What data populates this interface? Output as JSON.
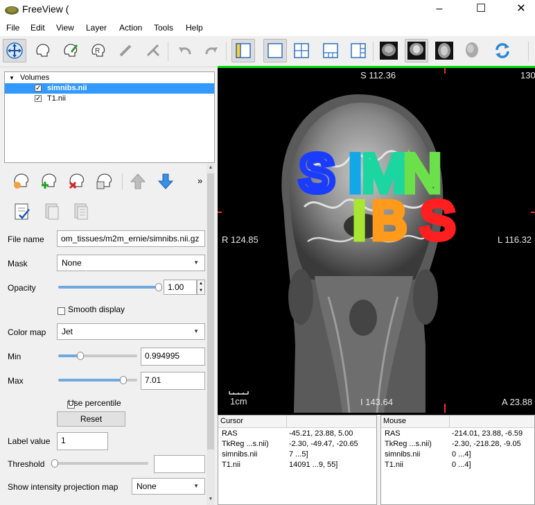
{
  "window": {
    "title": "FreeView (",
    "minimize": "–",
    "maximize": "☐",
    "close": "✕"
  },
  "menu": [
    "File",
    "Edit",
    "View",
    "Layer",
    "Action",
    "Tools",
    "Help"
  ],
  "layers": {
    "group": "Volumes",
    "items": [
      {
        "name": "simnibs.nii",
        "checked": true,
        "selected": true
      },
      {
        "name": "T1.nii",
        "checked": true,
        "selected": false
      }
    ]
  },
  "props": {
    "file_name_label": "File name",
    "file_name_value": "om_tissues/m2m_ernie/simnibs.nii.gz",
    "mask_label": "Mask",
    "mask_value": "None",
    "opacity_label": "Opacity",
    "opacity_value": "1.00",
    "smooth_label": "Smooth display",
    "colormap_label": "Color map",
    "colormap_value": "Jet",
    "min_label": "Min",
    "min_value": "0.994995",
    "max_label": "Max",
    "max_value": "7.01",
    "percentile_label": "Use percentile",
    "reset_label": "Reset",
    "label_value_label": "Label value",
    "label_value_value": "1",
    "threshold_label": "Threshold",
    "threshold_value": "",
    "projection_label": "Show intensity projection map",
    "projection_value": "None",
    "more": "»"
  },
  "viewer": {
    "top": "S 112.36",
    "top_right": "130",
    "left": "R 124.85",
    "right": "L 116.32",
    "bottom": "I 143.64",
    "bottom_right": "A 23.88",
    "scale": "1cm",
    "text_line1": "SIMN",
    "text_line2": "IBS"
  },
  "cursor_panel": {
    "header": "Cursor",
    "rows": [
      {
        "name": "RAS",
        "value": "-45.21, 23.88, 5.00"
      },
      {
        "name": "TkReg ...s.nii)",
        "value": "-2.30, -49.47, -20.65"
      },
      {
        "name": "simnibs.nii",
        "value": "7 ...5]"
      },
      {
        "name": "T1.nii",
        "value": "14091 ...9, 55]"
      }
    ]
  },
  "mouse_panel": {
    "header": "Mouse",
    "rows": [
      {
        "name": "RAS",
        "value": "-214.01, 23.88, -6.59"
      },
      {
        "name": "TkReg ...s.nii)",
        "value": "-2.30, -218.28, -9.05"
      },
      {
        "name": "simnibs.nii",
        "value": "0 ...4]"
      },
      {
        "name": "T1.nii",
        "value": "0 ...4]"
      }
    ]
  },
  "colors": {
    "accent": "#3399ff",
    "selection": "#3399ff",
    "viewer_border": "#00dd00"
  }
}
